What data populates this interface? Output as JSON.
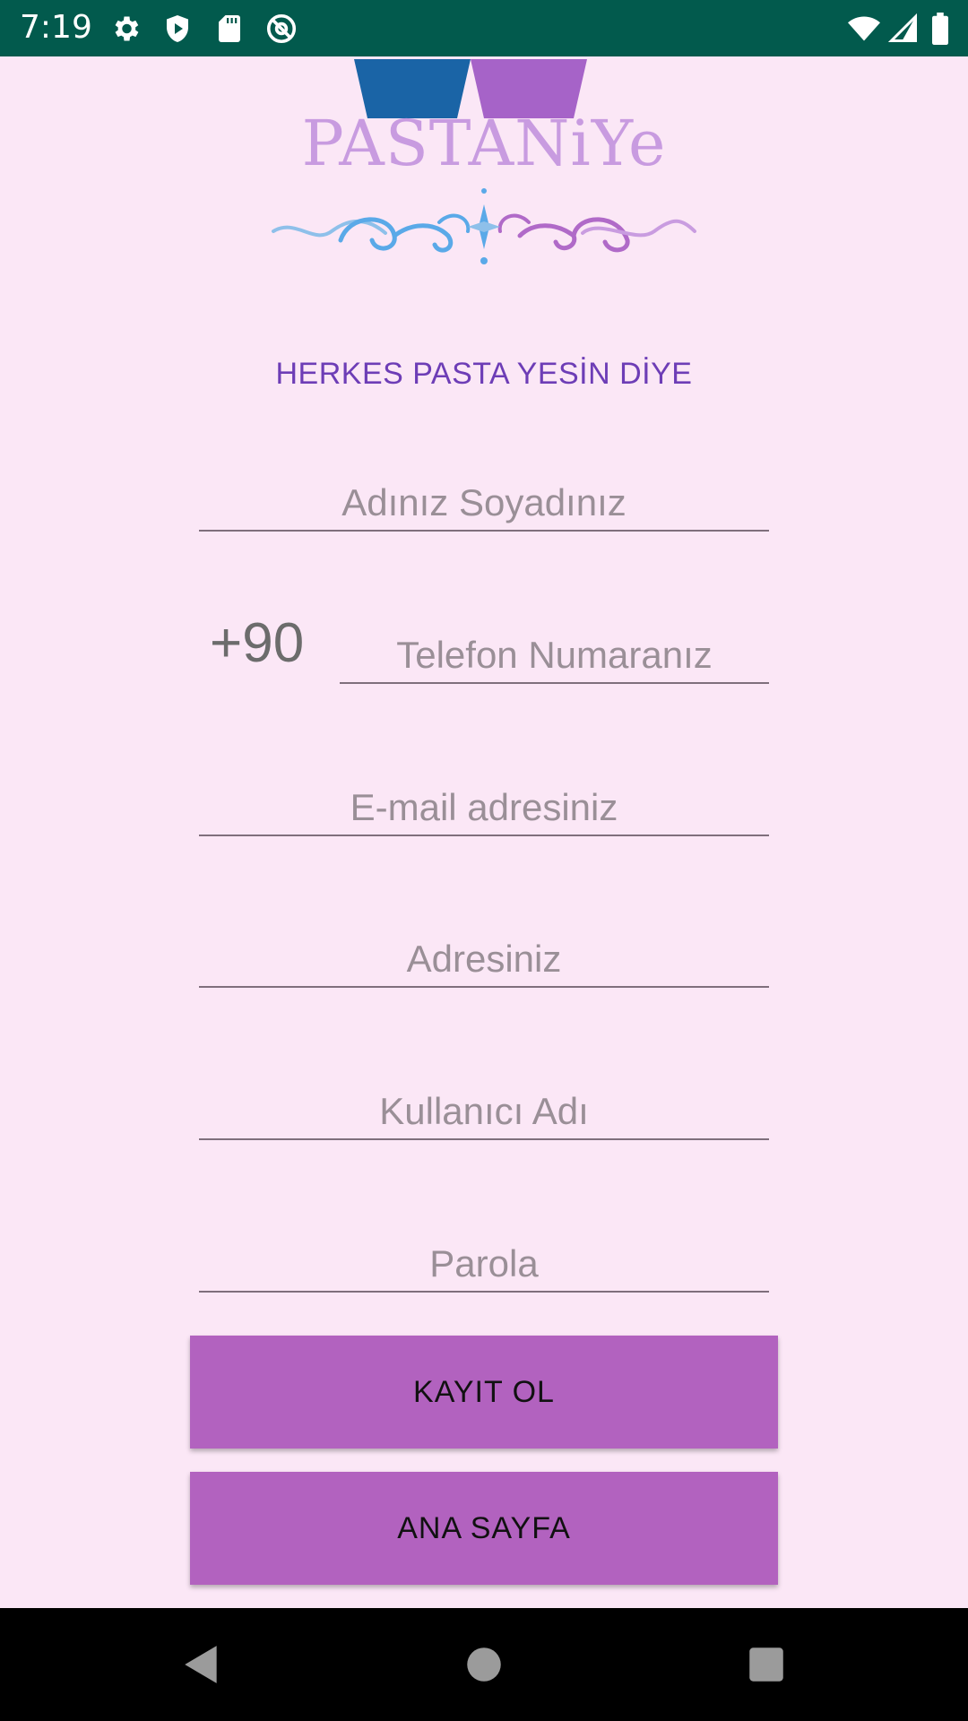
{
  "status_bar": {
    "time": "7:19",
    "left_icons": [
      "gear-icon",
      "play-protect-icon",
      "sd-card-icon",
      "at-sign-icon"
    ],
    "right_icons": [
      "wifi-icon",
      "signal-icon",
      "battery-icon"
    ]
  },
  "logo": {
    "text": "PASTANiYe"
  },
  "slogan": "HERKES PASTA YESİN DİYE",
  "form": {
    "name_placeholder": "Adınız Soyadınız",
    "country_code": "+90",
    "phone_placeholder": "Telefon Numaranız",
    "email_placeholder": "E-mail adresiniz",
    "address_placeholder": "Adresiniz",
    "username_placeholder": "Kullanıcı Adı",
    "password_placeholder": "Parola"
  },
  "buttons": {
    "register": "KAYIT OL",
    "home": "ANA SAYFA"
  },
  "colors": {
    "status_bar": "#025a4d",
    "background": "#fbe7f6",
    "button": "#b262bf",
    "slogan": "#6d3db6"
  }
}
